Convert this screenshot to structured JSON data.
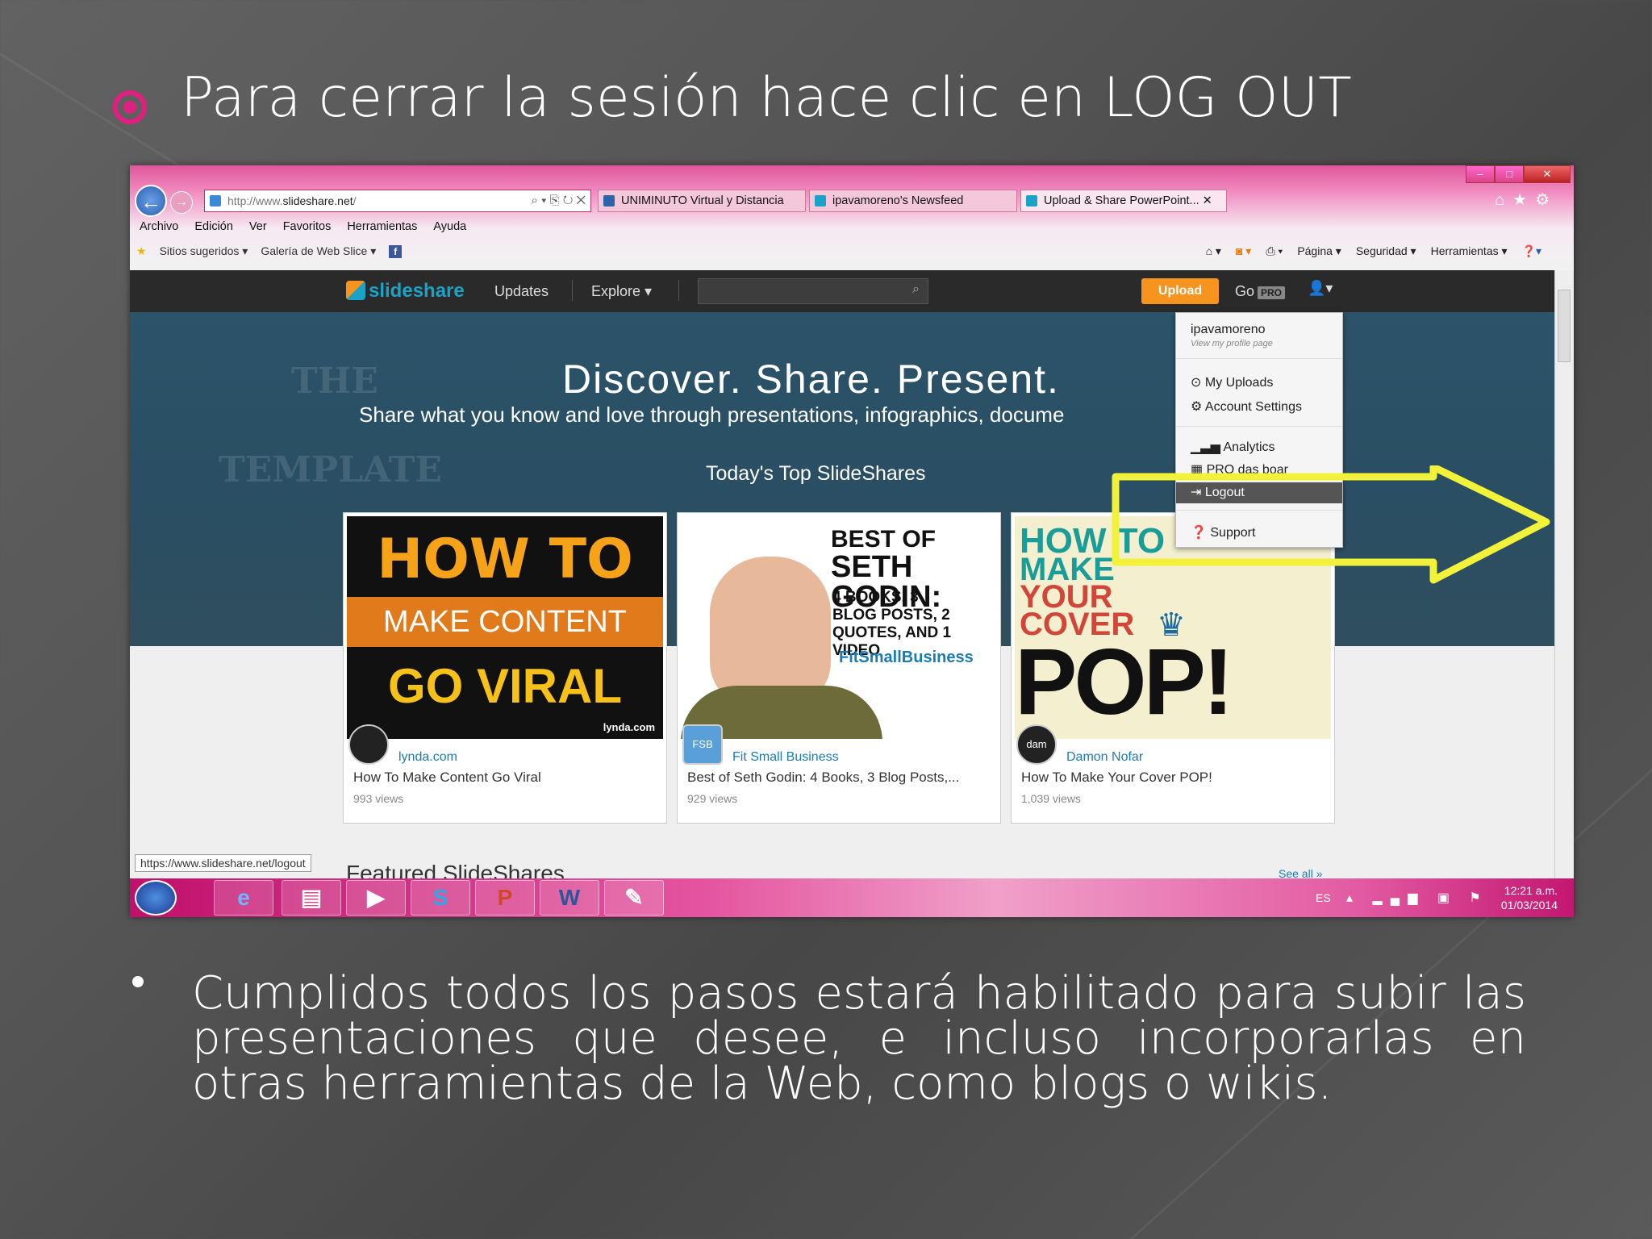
{
  "slide": {
    "title": "Para cerrar la sesión hace clic en LOG OUT",
    "body": "Cumplidos todos los pasos estará habilitado para subir las presentaciones que desee, e incluso incorporarlas en otras herramientas de la Web, como blogs o wikis.",
    "accent_color": "#e0207f"
  },
  "browser": {
    "address": {
      "prefix": "http://www.",
      "domain": "slideshare.net",
      "suffix": "/"
    },
    "tabs": [
      {
        "label": "UNIMINUTO Virtual y Distancia"
      },
      {
        "label": "ipavamoreno's Newsfeed"
      },
      {
        "label": "Upload & Share PowerPoint..."
      }
    ],
    "menu": [
      "Archivo",
      "Edición",
      "Ver",
      "Favoritos",
      "Herramientas",
      "Ayuda"
    ],
    "favorites": [
      "Sitios sugeridos ▾",
      "Galería de Web Slice ▾"
    ],
    "commands": [
      "Página ▾",
      "Seguridad ▾",
      "Herramientas ▾"
    ],
    "status_url": "https://www.slideshare.net/logout"
  },
  "slideshare": {
    "logo": "slideshare",
    "nav": {
      "updates": "Updates",
      "explore": "Explore ▾",
      "upload": "Upload",
      "go": "Go",
      "pro": "PRO"
    },
    "hero": {
      "title": "Discover. Share. Present.",
      "subtitle": "Share what you know and love through presentations, infographics, docume",
      "today": "Today's Top SlideShares"
    },
    "cards": [
      {
        "author": "lynda.com",
        "title": "How To Make Content Go Viral",
        "views": "993 views",
        "thumb": {
          "l1": "HOW TO",
          "l2": "MAKE CONTENT",
          "l3": "GO VIRAL",
          "brand": "lynda.com"
        },
        "avatar": ""
      },
      {
        "author": "Fit Small Business",
        "title": "Best of Seth Godin: 4 Books, 3 Blog Posts,...",
        "views": "929 views",
        "thumb": {
          "l1": "BEST OF",
          "l2": "SETH GODIN:",
          "l3": "4 BOOKS, 3 BLOG POSTS, 2 QUOTES, AND 1 VIDEO",
          "brand": "FitSmallBusiness"
        },
        "avatar": "FSB"
      },
      {
        "author": "Damon Nofar",
        "title": "How To Make Your Cover POP!",
        "views": "1,039 views",
        "thumb": {
          "l1": "HOW TO",
          "l2": "MAKE",
          "l3": "YOUR",
          "l4": "COVER",
          "l5": "POP!"
        },
        "avatar": "dam"
      }
    ],
    "featured": "Featured SlideShares",
    "see_all": "See all »"
  },
  "dropdown": {
    "username": "ipavamoreno",
    "profile": "View my profile page",
    "my_uploads": "My Uploads",
    "account_settings": "Account Settings",
    "analytics": "Analytics",
    "pro_dashboard": "PRO das  boar",
    "logout": "Logout",
    "support": "Support"
  },
  "taskbar": {
    "lang": "ES",
    "time": "12:21 a.m.",
    "date": "01/03/2014",
    "apps": [
      "ie-icon",
      "explorer-icon",
      "media-icon",
      "skype-icon",
      "powerpoint-icon",
      "word-icon",
      "paint-icon"
    ]
  },
  "highlight_color": "#f2f23a"
}
